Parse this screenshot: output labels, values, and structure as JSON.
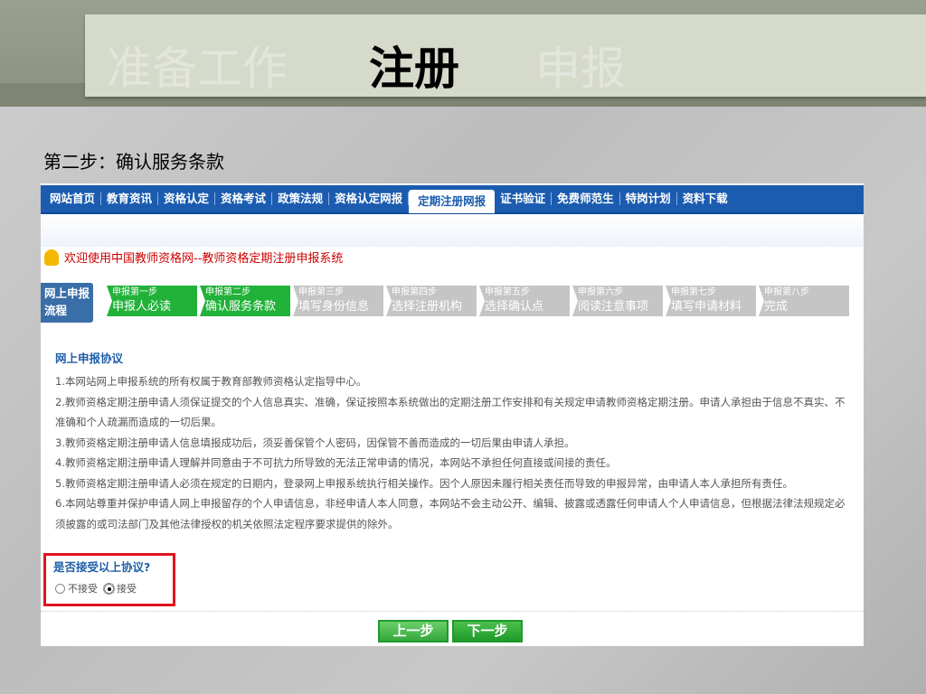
{
  "slide": {
    "tabs": [
      "准备工作",
      "注册",
      "申报"
    ],
    "active_tab": "注册",
    "subtitle": "第二步：确认服务条款"
  },
  "nav": [
    "网站首页",
    "教育资讯",
    "资格认定",
    "资格考试",
    "政策法规",
    "资格认定网报",
    "定期注册网报",
    "证书验证",
    "免费师范生",
    "特岗计划",
    "资料下载"
  ],
  "welcome": "欢迎使用中国教师资格网--教师资格定期注册申报系统",
  "flow_label": "网上申报流程",
  "steps": [
    {
      "n": "申报第一步",
      "t": "申报人必读"
    },
    {
      "n": "申报第二步",
      "t": "确认服务条款"
    },
    {
      "n": "申报第三步",
      "t": "填写身份信息"
    },
    {
      "n": "申报第四步",
      "t": "选择注册机构"
    },
    {
      "n": "申报第五步",
      "t": "选择确认点"
    },
    {
      "n": "申报第六步",
      "t": "阅读注意事项"
    },
    {
      "n": "申报第七步",
      "t": "填写申请材料"
    },
    {
      "n": "申报第八步",
      "t": "完成"
    }
  ],
  "agreement": {
    "title": "网上申报协议",
    "items": [
      "1.本网站网上申报系统的所有权属于教育部教师资格认定指导中心。",
      "2.教师资格定期注册申请人须保证提交的个人信息真实、准确，保证按照本系统做出的定期注册工作安排和有关规定申请教师资格定期注册。申请人承担由于信息不真实、不准确和个人疏漏而造成的一切后果。",
      "3.教师资格定期注册申请人信息填报成功后，须妥善保管个人密码，因保管不善而造成的一切后果由申请人承担。",
      "4.教师资格定期注册申请人理解并同意由于不可抗力所导致的无法正常申请的情况，本网站不承担任何直接或间接的责任。",
      "5.教师资格定期注册申请人必须在规定的日期内，登录网上申报系统执行相关操作。因个人原因未履行相关责任而导致的申报异常，由申请人本人承担所有责任。",
      "6.本网站尊重并保护申请人网上申报留存的个人申请信息，非经申请人本人同意，本网站不会主动公开、编辑、披露或透露任何申请人个人申请信息，但根据法律法规规定必须披露的或司法部门及其他法律授权的机关依照法定程序要求提供的除外。"
    ]
  },
  "question": "是否接受以上协议?",
  "options": {
    "reject": "不接受",
    "accept": "接受",
    "selected": "接受"
  },
  "buttons": {
    "prev": "上一步",
    "next": "下一步"
  }
}
